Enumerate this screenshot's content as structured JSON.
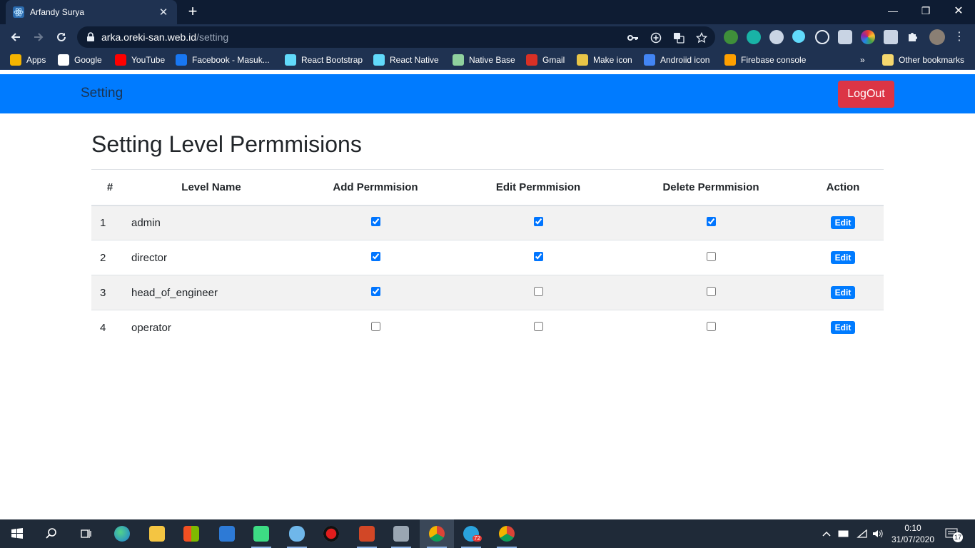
{
  "browser": {
    "tab_title": "Arfandy Surya",
    "url_host": "arka.oreki-san.web.id",
    "url_path": "/setting",
    "bookmarks": [
      {
        "label": "Apps",
        "icon": "apps-grid-icon",
        "color": "#f4b400"
      },
      {
        "label": "Google",
        "icon": "google-icon",
        "color": "#ffffff"
      },
      {
        "label": "YouTube",
        "icon": "youtube-icon",
        "color": "#ff0000"
      },
      {
        "label": "Facebook - Masuk...",
        "icon": "facebook-icon",
        "color": "#1877f2"
      },
      {
        "label": "React Bootstrap",
        "icon": "react-bootstrap-icon",
        "color": "#61dafb"
      },
      {
        "label": "React Native",
        "icon": "react-icon",
        "color": "#61dafb"
      },
      {
        "label": "Native Base",
        "icon": "native-base-icon",
        "color": "#8fd19e"
      },
      {
        "label": "Gmail",
        "icon": "gmail-icon",
        "color": "#d93025"
      },
      {
        "label": "Make icon",
        "icon": "make-icon-icon",
        "color": "#e8c547"
      },
      {
        "label": "Androiid icon",
        "icon": "android-icon",
        "color": "#4285f4"
      },
      {
        "label": "Firebase console",
        "icon": "firebase-icon",
        "color": "#ffa000"
      }
    ],
    "overflow_label": "»",
    "other_bookmarks": "Other bookmarks"
  },
  "navbar": {
    "brand": "Setting",
    "logout_label": "LogOut"
  },
  "page": {
    "heading": "Setting Level Permmisions",
    "table": {
      "headers": [
        "#",
        "Level Name",
        "Add Permmision",
        "Edit Permmision",
        "Delete Permmision",
        "Action"
      ],
      "rows": [
        {
          "num": "1",
          "name": "admin",
          "add": true,
          "edit": true,
          "delete": true,
          "action": "Edit"
        },
        {
          "num": "2",
          "name": "director",
          "add": true,
          "edit": true,
          "delete": false,
          "action": "Edit"
        },
        {
          "num": "3",
          "name": "head_of_engineer",
          "add": true,
          "edit": false,
          "delete": false,
          "action": "Edit"
        },
        {
          "num": "4",
          "name": "operator",
          "add": false,
          "edit": false,
          "delete": false,
          "action": "Edit"
        }
      ]
    }
  },
  "taskbar": {
    "time": "0:10",
    "date": "31/07/2020",
    "telegram_badge": "72",
    "notification_count": "17"
  },
  "colors": {
    "primary": "#007bff",
    "danger": "#dc3545",
    "chrome_bg": "#1f3251"
  }
}
